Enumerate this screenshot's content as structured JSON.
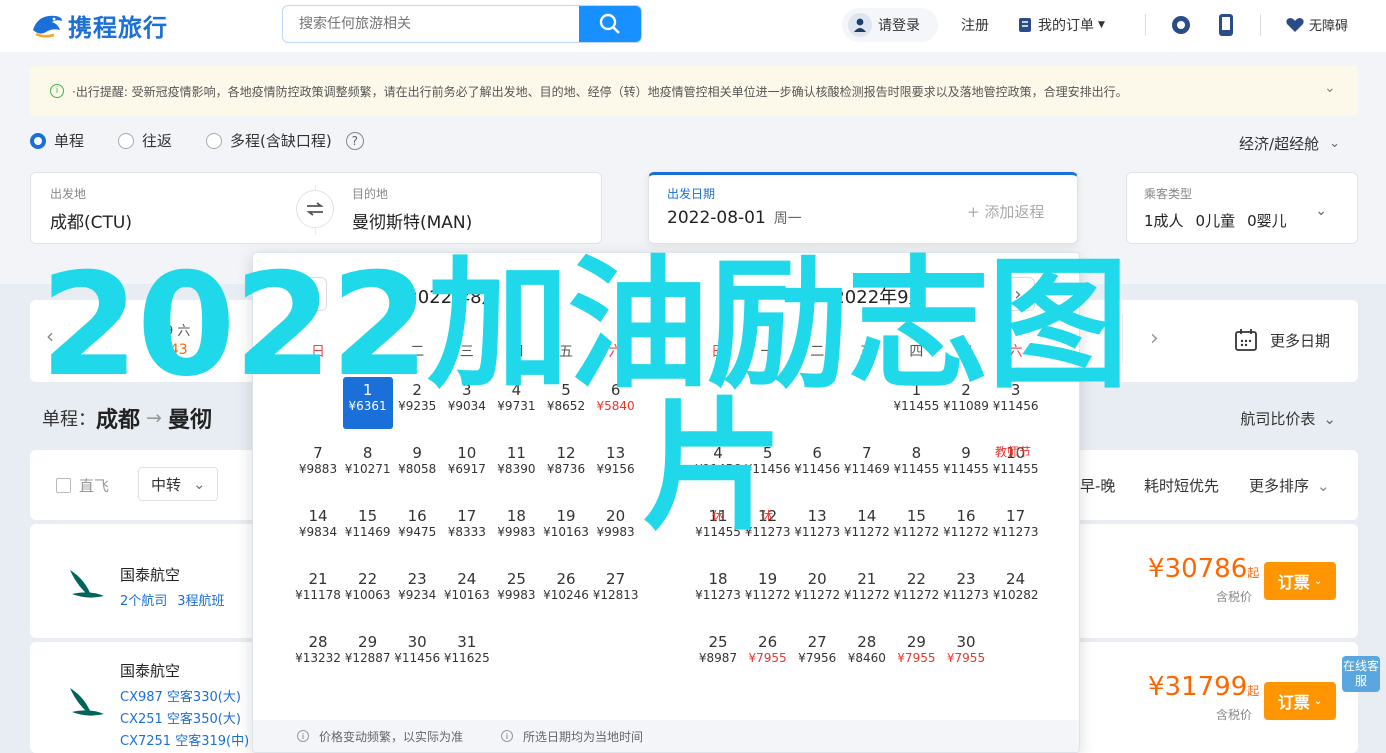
{
  "brand": {
    "name": "携程旅行",
    "color": "#1a6fd8"
  },
  "search": {
    "placeholder": "搜索任何旅游相关"
  },
  "header": {
    "login": "请登录",
    "register": "注册",
    "orders": "我的订单",
    "accessibility": "无障碍"
  },
  "notice": {
    "text": "·出行提醒: 受新冠疫情影响，各地疫情防控政策调整频繁，请在出行前务必了解出发地、目的地、经停（转）地疫情管控相关单位进一步确认核酸检测报告时限要求以及落地管控政策，合理安排出行。"
  },
  "trip_types": [
    "单程",
    "往返",
    "多程(含缺口程)"
  ],
  "cabin": "经济/超经舱",
  "form": {
    "from_label": "出发地",
    "from_value": "成都(CTU)",
    "to_label": "目的地",
    "to_value": "曼彻斯特(MAN)",
    "date_label": "出发日期",
    "date_value": "2022-08-01",
    "weekday": "周一",
    "add_return": "+ 添加返程",
    "pax_label": "乘客类型",
    "pax_adult": "1成人",
    "pax_child": "0儿童",
    "pax_infant": "0婴儿"
  },
  "date_strip": {
    "partial_date": "-29 六",
    "partial_price": "543",
    "more_dates": "更多日期"
  },
  "segment": {
    "label": "单程：",
    "from": "成都",
    "to_partial": "曼彻"
  },
  "compare": "航司比价表",
  "filters": {
    "direct": "直飞",
    "transfer": "中转",
    "early_late": "早-晚",
    "shortest": "耗时短优先",
    "more_sort": "更多排序"
  },
  "flights": [
    {
      "airline": "国泰航空",
      "sub1": "2个航司",
      "sub2": "3程航班",
      "price": "¥30786",
      "qi": "起",
      "tax": "含税价",
      "book": "订票"
    },
    {
      "airline": "国泰航空",
      "legs": [
        "CX987 空客330(大)",
        "CX251 空客350(大)",
        "CX7251 空客319(中)"
      ],
      "price": "¥31799",
      "qi": "起",
      "tax": "含税价",
      "book": "订票"
    }
  ],
  "calendar": {
    "left_title": "2022年8月",
    "right_title": "2022年9月",
    "weekdays": [
      "日",
      "一",
      "二",
      "三",
      "四",
      "五",
      "六"
    ],
    "aug_rows": [
      [
        null,
        [
          "1",
          "¥6361"
        ],
        [
          "2",
          "¥9235"
        ],
        [
          "3",
          "¥9034"
        ],
        [
          "4",
          "¥9731"
        ],
        [
          "5",
          "¥8652"
        ],
        [
          "6",
          "¥5840"
        ]
      ],
      [
        [
          "7",
          "¥9883"
        ],
        [
          "8",
          "¥10271"
        ],
        [
          "9",
          "¥8058"
        ],
        [
          "10",
          "¥6917"
        ],
        [
          "11",
          "¥8390"
        ],
        [
          "12",
          "¥8736"
        ],
        [
          "13",
          "¥9156"
        ]
      ],
      [
        [
          "14",
          "¥9834"
        ],
        [
          "15",
          "¥11469"
        ],
        [
          "16",
          "¥9475"
        ],
        [
          "17",
          "¥8333"
        ],
        [
          "18",
          "¥9983"
        ],
        [
          "19",
          "¥10163"
        ],
        [
          "20",
          "¥9983"
        ]
      ],
      [
        [
          "21",
          "¥11178"
        ],
        [
          "22",
          "¥10063"
        ],
        [
          "23",
          "¥9234"
        ],
        [
          "24",
          "¥10163"
        ],
        [
          "25",
          "¥9983"
        ],
        [
          "26",
          "¥10246"
        ],
        [
          "27",
          "¥12813"
        ]
      ],
      [
        [
          "28",
          "¥13232"
        ],
        [
          "29",
          "¥12887"
        ],
        [
          "30",
          "¥11456"
        ],
        [
          "31",
          "¥11625"
        ],
        null,
        null,
        null
      ]
    ],
    "sep_rows": [
      [
        null,
        null,
        null,
        null,
        [
          "1",
          "¥11455"
        ],
        [
          "2",
          "¥11089"
        ],
        [
          "3",
          "¥11456"
        ]
      ],
      [
        [
          "4",
          "¥11456"
        ],
        [
          "5",
          "¥11456"
        ],
        [
          "6",
          "¥11456"
        ],
        [
          "7",
          "¥11469"
        ],
        [
          "8",
          "¥11455"
        ],
        [
          "9",
          "¥11455"
        ],
        [
          "10",
          "¥11455"
        ]
      ],
      [
        [
          "11",
          "¥11455"
        ],
        [
          "12",
          "¥11273"
        ],
        [
          "13",
          "¥11273"
        ],
        [
          "14",
          "¥11272"
        ],
        [
          "15",
          "¥11272"
        ],
        [
          "16",
          "¥11272"
        ],
        [
          "17",
          "¥11273"
        ]
      ],
      [
        [
          "18",
          "¥11273"
        ],
        [
          "19",
          "¥11272"
        ],
        [
          "20",
          "¥11272"
        ],
        [
          "21",
          "¥11272"
        ],
        [
          "22",
          "¥11272"
        ],
        [
          "23",
          "¥11273"
        ],
        [
          "24",
          "¥10282"
        ]
      ],
      [
        [
          "25",
          "¥8987"
        ],
        [
          "26",
          "¥7955"
        ],
        [
          "27",
          "¥7956"
        ],
        [
          "28",
          "¥8460"
        ],
        [
          "29",
          "¥7955"
        ],
        [
          "30",
          "¥7955"
        ],
        null
      ]
    ],
    "low_prices": [
      "¥5840",
      "¥7955"
    ],
    "teachers_day": "教师节",
    "holiday_work": "休",
    "holiday_rest": "休",
    "footer_left": "价格变动频繁，以实际为准",
    "footer_right": "所选日期均为当地时间"
  },
  "overlay_text": "2022加油励志图片",
  "side_button": "在线客服"
}
